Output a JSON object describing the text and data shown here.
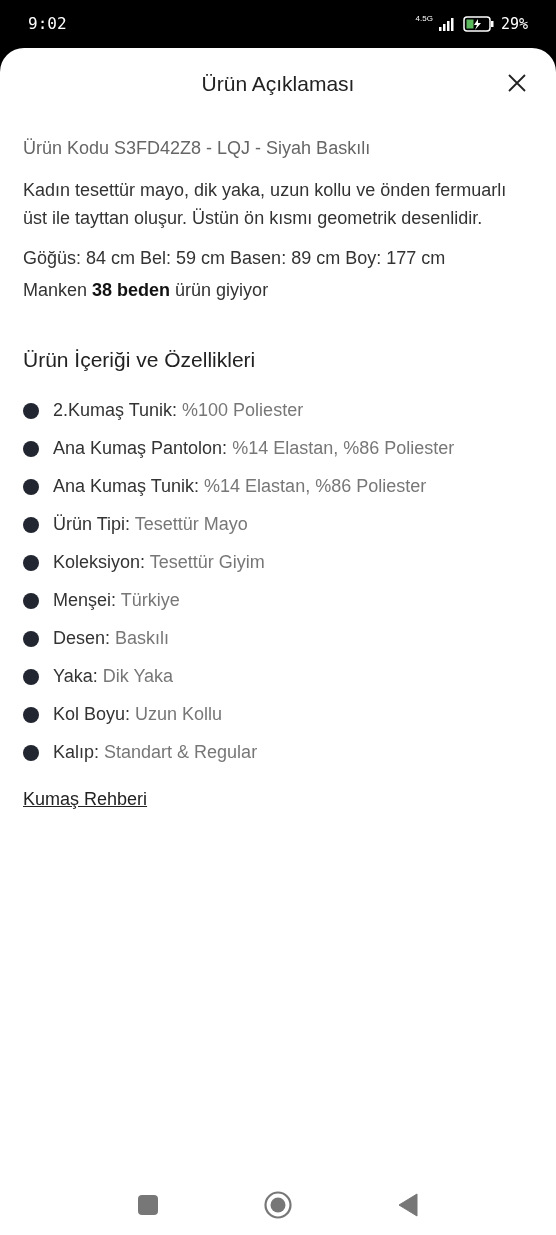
{
  "status_bar": {
    "time": "9:02",
    "network": "4.5G",
    "battery": "29%"
  },
  "sheet": {
    "title": "Ürün Açıklaması"
  },
  "product_code": "Ürün Kodu S3FD42Z8 - LQJ - Siyah Baskılı",
  "description": "Kadın tesettür mayo, dik yaka, uzun kollu ve önden fermuarlı üst ile tayttan oluşur. Üstün ön kısmı geometrik desenlidir.",
  "measurements": "Göğüs: 84 cm Bel: 59 cm Basen: 89 cm Boy: 177 cm",
  "model_size": "Manken **38 beden** ürün giyiyor",
  "features_heading": "Ürün İçeriği ve Özellikleri",
  "features": [
    {
      "label": "2.Kumaş Tunik:",
      "value": "%100 Poliester"
    },
    {
      "label": "Ana Kumaş Pantolon:",
      "value": "%14 Elastan, %86 Poliester"
    },
    {
      "label": "Ana Kumaş Tunik:",
      "value": "%14 Elastan, %86 Poliester"
    },
    {
      "label": "Ürün Tipi:",
      "value": "Tesettür Mayo"
    },
    {
      "label": "Koleksiyon:",
      "value": "Tesettür Giyim"
    },
    {
      "label": "Menşei:",
      "value": "Türkiye"
    },
    {
      "label": "Desen:",
      "value": "Baskılı"
    },
    {
      "label": "Yaka:",
      "value": "Dik Yaka"
    },
    {
      "label": "Kol Boyu:",
      "value": "Uzun Kollu"
    },
    {
      "label": "Kalıp:",
      "value": "Standart & Regular"
    }
  ],
  "fabric_guide_link": "Kumaş Rehberi"
}
